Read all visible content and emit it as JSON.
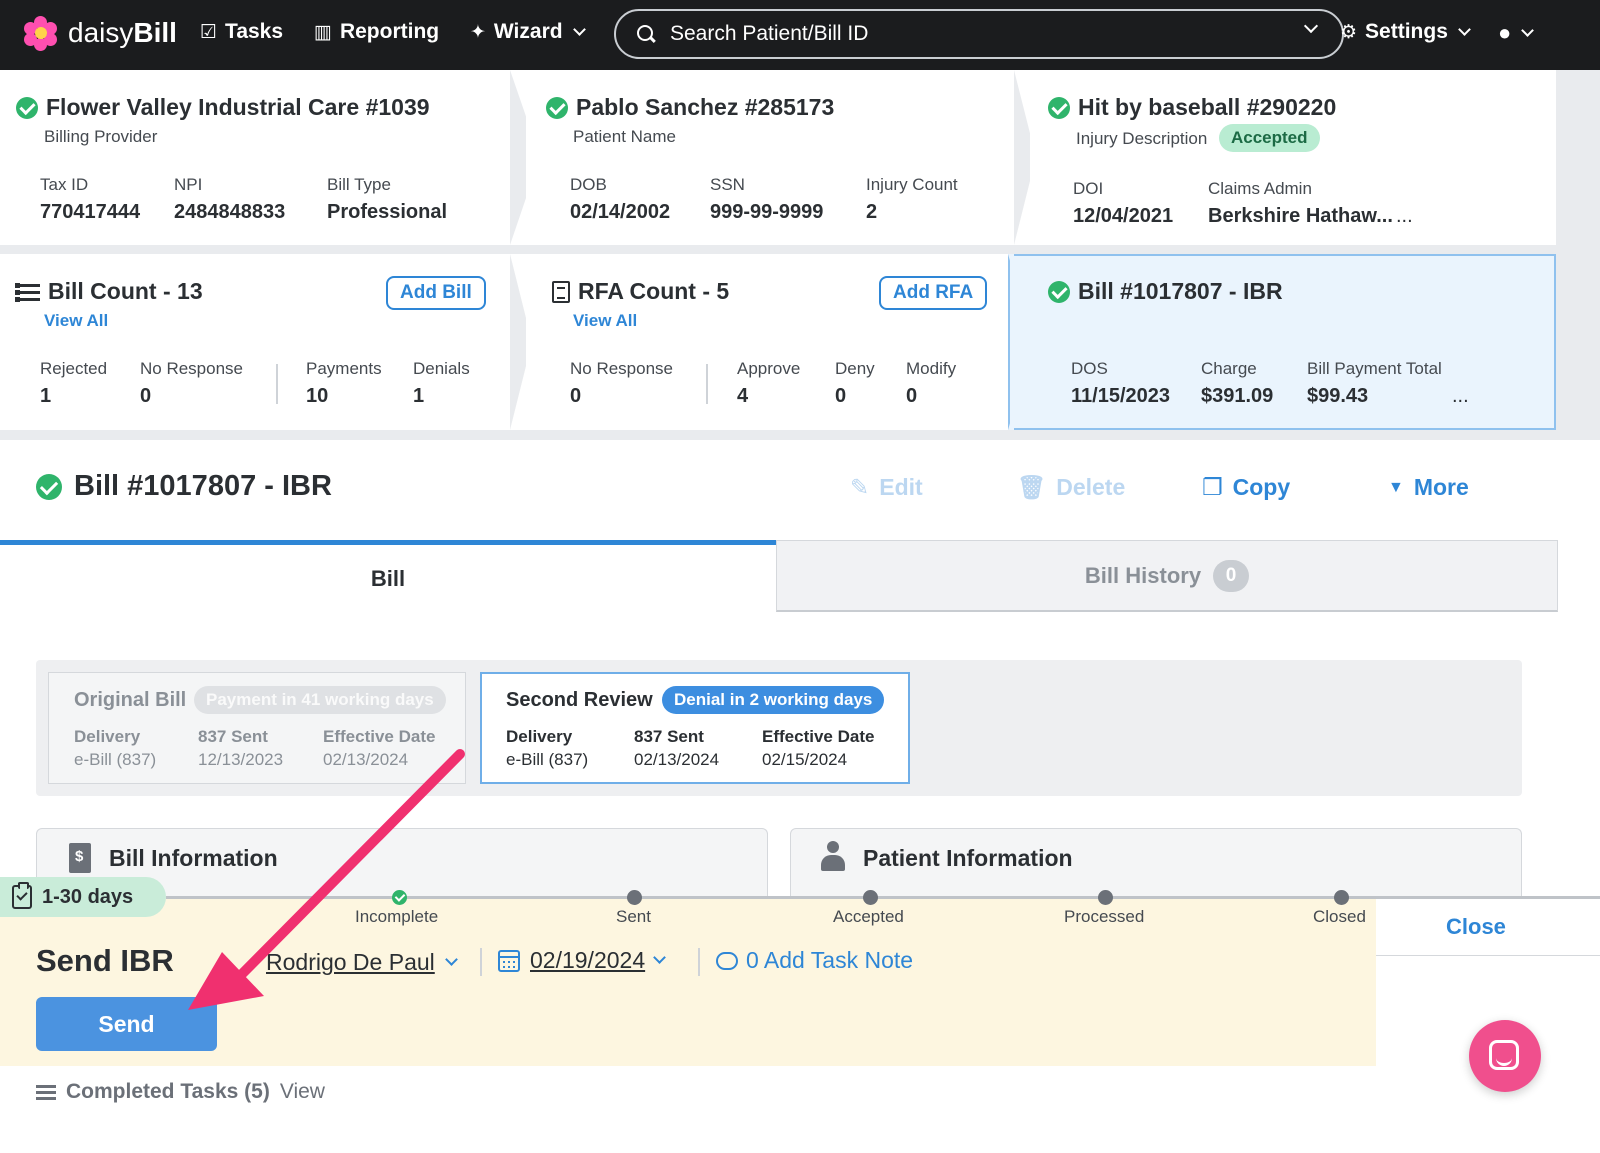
{
  "nav": {
    "logo_a": "daisy",
    "logo_b": "Bill",
    "tasks": "Tasks",
    "reporting": "Reporting",
    "wizard": "Wizard",
    "search_placeholder": "Search Patient/Bill ID",
    "settings": "Settings"
  },
  "provider": {
    "title": "Flower Valley Industrial Care #1039",
    "subtitle": "Billing Provider",
    "tax_id_label": "Tax ID",
    "tax_id": "770417444",
    "npi_label": "NPI",
    "npi": "2484848833",
    "bill_type_label": "Bill Type",
    "bill_type": "Professional"
  },
  "patient": {
    "title": "Pablo Sanchez #285173",
    "subtitle": "Patient Name",
    "dob_label": "DOB",
    "dob": "02/14/2002",
    "ssn_label": "SSN",
    "ssn": "999-99-9999",
    "injury_count_label": "Injury Count",
    "injury_count": "2"
  },
  "injury": {
    "title": "Hit by baseball #290220",
    "subtitle": "Injury Description",
    "status": "Accepted",
    "doi_label": "DOI",
    "doi": "12/04/2021",
    "claims_admin_label": "Claims Admin",
    "claims_admin": "Berkshire Hathaw...",
    "more": "..."
  },
  "bill_count": {
    "title": "Bill Count - 13",
    "add": "Add Bill",
    "view_all": "View All",
    "rejected_label": "Rejected",
    "rejected": "1",
    "no_response_label": "No Response",
    "no_response": "0",
    "payments_label": "Payments",
    "payments": "10",
    "denials_label": "Denials",
    "denials": "1"
  },
  "rfa_count": {
    "title": "RFA Count - 5",
    "add": "Add RFA",
    "view_all": "View All",
    "no_response_label": "No Response",
    "no_response": "0",
    "approve_label": "Approve",
    "approve": "4",
    "deny_label": "Deny",
    "deny": "0",
    "modify_label": "Modify",
    "modify": "0"
  },
  "bill_summary": {
    "title": "Bill #1017807 - IBR",
    "dos_label": "DOS",
    "dos": "11/15/2023",
    "charge_label": "Charge",
    "charge": "$391.09",
    "payment_total_label": "Bill Payment Total",
    "payment_total": "$99.43",
    "more": "..."
  },
  "bill_header": {
    "title": "Bill #1017807 - IBR",
    "edit": "Edit",
    "delete": "Delete",
    "copy": "Copy",
    "more": "More"
  },
  "tabs": {
    "bill": "Bill",
    "history": "Bill History",
    "history_count": "0"
  },
  "reviews": {
    "original": {
      "title": "Original Bill",
      "badge": "Payment in 41 working days",
      "delivery_label": "Delivery",
      "delivery": "e-Bill (837)",
      "sent_label": "837 Sent",
      "sent": "12/13/2023",
      "effective_label": "Effective Date",
      "effective": "02/13/2024"
    },
    "second": {
      "title": "Second Review",
      "badge": "Denial in 2 working days",
      "delivery_label": "Delivery",
      "delivery": "e-Bill (837)",
      "sent_label": "837 Sent",
      "sent": "02/13/2024",
      "effective_label": "Effective Date",
      "effective": "02/15/2024"
    }
  },
  "info": {
    "bill_information": "Bill Information",
    "patient_information": "Patient Information"
  },
  "task": {
    "days": "1-30 days",
    "steps": [
      "Incomplete",
      "Sent",
      "Accepted",
      "Processed",
      "Closed"
    ],
    "close": "Close",
    "name": "Send IBR",
    "assignee": "Rodrigo De Paul",
    "due_date": "02/19/2024",
    "note": "0 Add Task Note",
    "send": "Send"
  },
  "completed": {
    "label": "Completed Tasks (5)",
    "view": "View"
  },
  "colors": {
    "accent": "#2e86d6",
    "success": "#2fb46b",
    "annotation_arrow": "#f0306f",
    "task_bg": "#fdf6e0"
  }
}
